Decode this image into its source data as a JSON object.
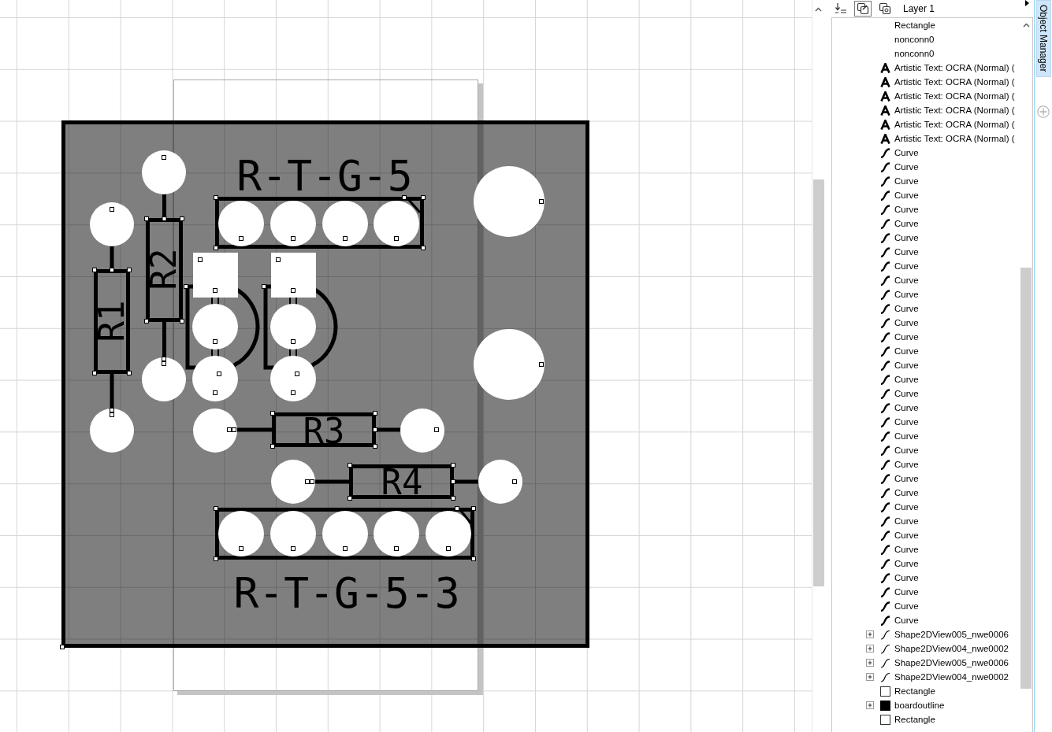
{
  "canvas": {
    "board": {
      "resistors": [
        {
          "label": "R1",
          "kind": "vertical"
        },
        {
          "label": "R2",
          "kind": "vertical"
        },
        {
          "label": "R3",
          "kind": "horizontal"
        },
        {
          "label": "R4",
          "kind": "horizontal"
        }
      ],
      "connectors": [
        {
          "label": "R-T-G-5"
        },
        {
          "label": "R-T-G-5-3"
        }
      ]
    }
  },
  "object_manager": {
    "view_buttons": [
      {
        "selected": true
      },
      {
        "selected": false
      }
    ],
    "layer": "Layer 1",
    "items": [
      {
        "label": "Rectangle",
        "kind": "plain"
      },
      {
        "label": "nonconn0",
        "kind": "plain"
      },
      {
        "label": "nonconn0",
        "kind": "plain"
      },
      {
        "label": "Artistic Text: OCRA (Normal) (",
        "kind": "text"
      },
      {
        "label": "Artistic Text: OCRA (Normal) (",
        "kind": "text"
      },
      {
        "label": "Artistic Text: OCRA (Normal) (",
        "kind": "text"
      },
      {
        "label": "Artistic Text: OCRA (Normal) (",
        "kind": "text"
      },
      {
        "label": "Artistic Text: OCRA (Normal) (",
        "kind": "text"
      },
      {
        "label": "Artistic Text: OCRA (Normal) (",
        "kind": "text"
      },
      {
        "label": "Curve",
        "kind": "curve"
      },
      {
        "label": "Curve",
        "kind": "curve"
      },
      {
        "label": "Curve",
        "kind": "curve"
      },
      {
        "label": "Curve",
        "kind": "curve"
      },
      {
        "label": "Curve",
        "kind": "curve"
      },
      {
        "label": "Curve",
        "kind": "curve"
      },
      {
        "label": "Curve",
        "kind": "curve"
      },
      {
        "label": "Curve",
        "kind": "curve"
      },
      {
        "label": "Curve",
        "kind": "curve"
      },
      {
        "label": "Curve",
        "kind": "curve"
      },
      {
        "label": "Curve",
        "kind": "curve"
      },
      {
        "label": "Curve",
        "kind": "curve"
      },
      {
        "label": "Curve",
        "kind": "curve"
      },
      {
        "label": "Curve",
        "kind": "curve"
      },
      {
        "label": "Curve",
        "kind": "curve"
      },
      {
        "label": "Curve",
        "kind": "curve"
      },
      {
        "label": "Curve",
        "kind": "curve"
      },
      {
        "label": "Curve",
        "kind": "curve"
      },
      {
        "label": "Curve",
        "kind": "curve"
      },
      {
        "label": "Curve",
        "kind": "curve"
      },
      {
        "label": "Curve",
        "kind": "curve"
      },
      {
        "label": "Curve",
        "kind": "curve"
      },
      {
        "label": "Curve",
        "kind": "curve"
      },
      {
        "label": "Curve",
        "kind": "curve"
      },
      {
        "label": "Curve",
        "kind": "curve"
      },
      {
        "label": "Curve",
        "kind": "curve"
      },
      {
        "label": "Curve",
        "kind": "curve"
      },
      {
        "label": "Curve",
        "kind": "curve"
      },
      {
        "label": "Curve",
        "kind": "curve"
      },
      {
        "label": "Curve",
        "kind": "curve"
      },
      {
        "label": "Curve",
        "kind": "curve"
      },
      {
        "label": "Curve",
        "kind": "curve"
      },
      {
        "label": "Curve",
        "kind": "curve"
      },
      {
        "label": "Curve",
        "kind": "curve"
      },
      {
        "label": "Shape2DView005_nwe0006",
        "kind": "shape",
        "expanded": false
      },
      {
        "label": "Shape2DView004_nwe0002",
        "kind": "shape",
        "expanded": false
      },
      {
        "label": "Shape2DView005_nwe0006",
        "kind": "shape",
        "expanded": false
      },
      {
        "label": "Shape2DView004_nwe0002",
        "kind": "shape",
        "expanded": false
      },
      {
        "label": "Rectangle",
        "kind": "rectangle"
      },
      {
        "label": "boardoutline",
        "kind": "filled",
        "expanded": false
      },
      {
        "label": "Rectangle",
        "kind": "rectangle"
      }
    ]
  },
  "docker_tab": {
    "label": "Object Manager",
    "selected": true
  }
}
